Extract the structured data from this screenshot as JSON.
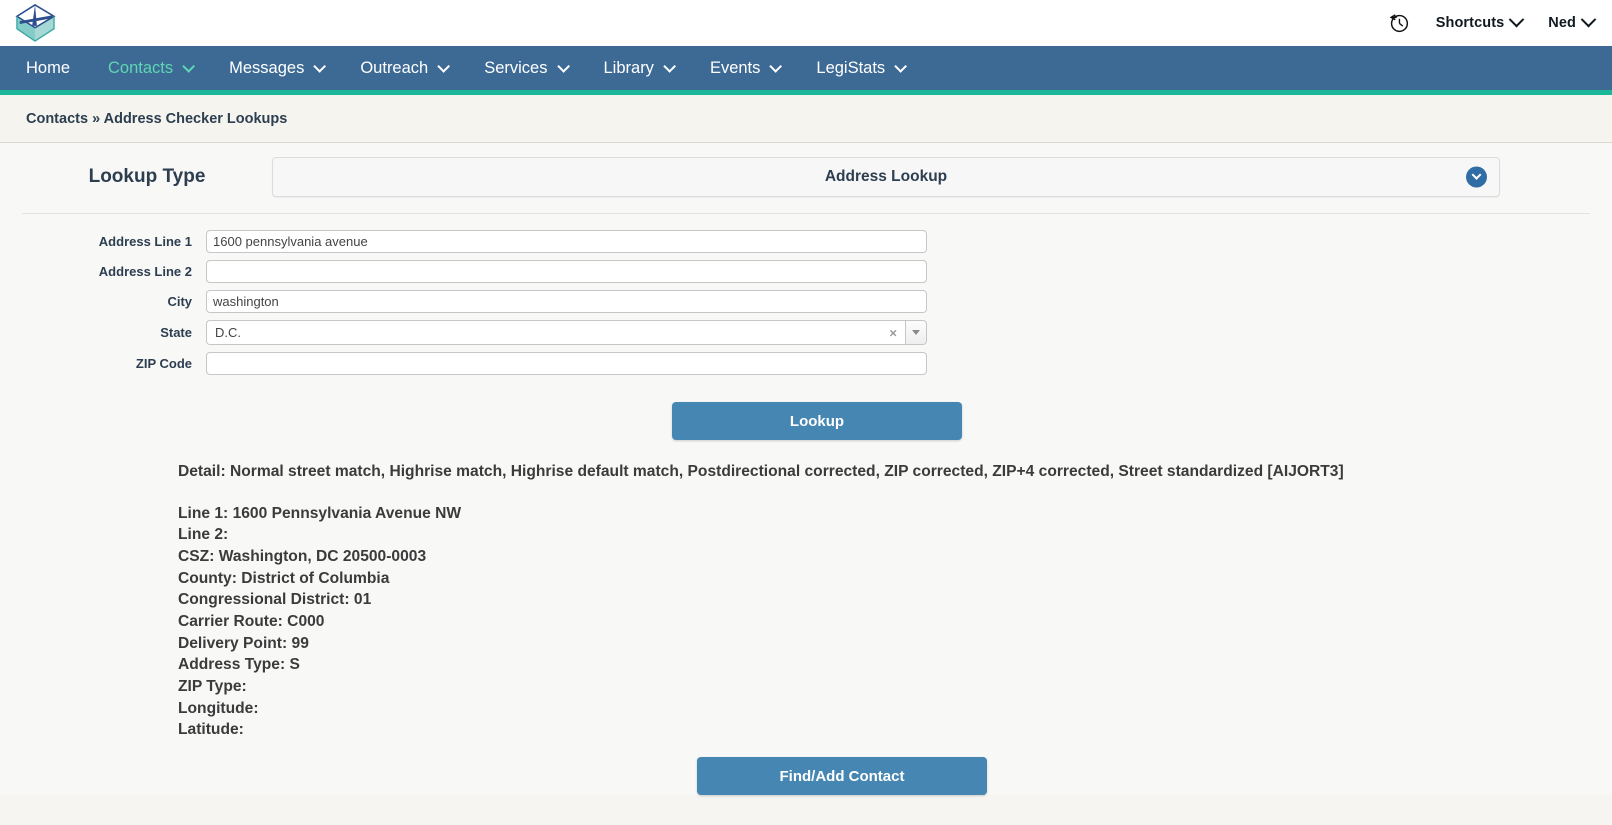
{
  "header": {
    "logo_icon": "envelope-arrow-logo",
    "history_icon": "clock-history-icon",
    "shortcuts_label": "Shortcuts",
    "user_label": "Ned"
  },
  "nav": {
    "items": [
      {
        "label": "Home",
        "has_caret": false,
        "active": false
      },
      {
        "label": "Contacts",
        "has_caret": true,
        "active": true
      },
      {
        "label": "Messages",
        "has_caret": true,
        "active": false
      },
      {
        "label": "Outreach",
        "has_caret": true,
        "active": false
      },
      {
        "label": "Services",
        "has_caret": true,
        "active": false
      },
      {
        "label": "Library",
        "has_caret": true,
        "active": false
      },
      {
        "label": "Events",
        "has_caret": true,
        "active": false
      },
      {
        "label": "LegiStats",
        "has_caret": true,
        "active": false
      }
    ],
    "background_color": "#3d6a94",
    "active_color": "#5fd6b4",
    "underline_color": "#1cb698"
  },
  "breadcrumb": {
    "text": "Contacts » Address Checker Lookups"
  },
  "lookup_type": {
    "label": "Lookup Type",
    "selected": "Address Lookup",
    "arrow_icon": "chevron-down-circle-icon"
  },
  "form": {
    "fields": [
      {
        "label": "Address Line 1",
        "value": "1600 pennsylvania avenue",
        "placeholder": "",
        "type": "text"
      },
      {
        "label": "Address Line 2",
        "value": "",
        "placeholder": "",
        "type": "text"
      },
      {
        "label": "City",
        "value": "washington",
        "placeholder": "",
        "type": "text"
      },
      {
        "label": "State",
        "value": "D.C.",
        "placeholder": "",
        "type": "select2"
      },
      {
        "label": "ZIP Code",
        "value": "",
        "placeholder": "",
        "type": "text"
      }
    ],
    "state_clear_icon": "clear-x-icon",
    "state_dropdown_icon": "caret-down-icon",
    "lookup_button": "Lookup"
  },
  "result": {
    "detail": "Detail: Normal street match, Highrise match, Highrise default match, Postdirectional corrected, ZIP corrected, ZIP+4 corrected, Street standardized [AIJORT3]",
    "lines": [
      "Line 1: 1600 Pennsylvania Avenue NW",
      "Line 2:",
      "CSZ: Washington, DC 20500-0003",
      "County: District of Columbia",
      "Congressional District: 01",
      "Carrier Route: C000",
      "Delivery Point: 99",
      "Address Type: S",
      "ZIP Type:",
      "Longitude:",
      "Latitude:"
    ]
  },
  "footer": {
    "find_add_button": "Find/Add Contact"
  },
  "colors": {
    "nav_blue": "#3d6a94",
    "teal": "#1cb698",
    "button_blue": "#4586b3",
    "text_dark": "#2c3e50",
    "page_bg": "#f8f8f7",
    "breadcrumb_bg": "#f5f4ef"
  }
}
